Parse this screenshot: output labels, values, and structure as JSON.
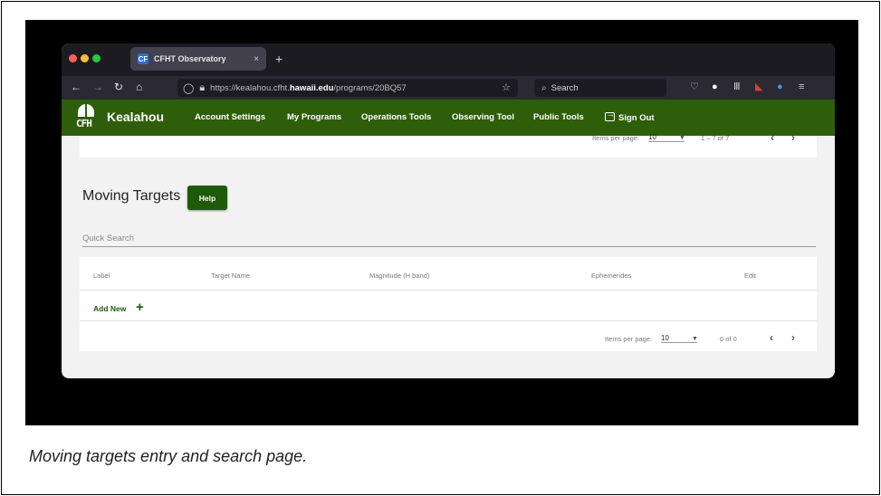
{
  "browser": {
    "tab_title": "CFHT Observatory",
    "tab_favicon": "CF",
    "tab_close": "×",
    "new_tab": "+",
    "url_prefix": "https://kealahou.cfht.",
    "url_domain": "hawaii.edu",
    "url_path": "/programs/20BQ57",
    "search_placeholder": "Search"
  },
  "site": {
    "logo_text": "CFH",
    "brand": "Kealahou",
    "menu": [
      "Account Settings",
      "My Programs",
      "Operations Tools",
      "Observing Tool",
      "Public Tools",
      "Sign Out"
    ]
  },
  "top_pagination": {
    "items_per_page_label": "Items per page:",
    "items_per_page_value": "10",
    "range": "1 – 7 of 7"
  },
  "moving_targets": {
    "title": "Moving Targets",
    "help_button": "Help",
    "quick_search_placeholder": "Quick Search",
    "columns": [
      "Label",
      "Target Name",
      "Magnitude (H band)",
      "Ephemerides",
      "Edit"
    ],
    "add_new": "Add New",
    "add_new_icon": "+",
    "pagination": {
      "items_per_page_label": "Items per page:",
      "items_per_page_value": "10",
      "range": "0 of 0"
    }
  },
  "caption": "Moving targets entry and search page."
}
